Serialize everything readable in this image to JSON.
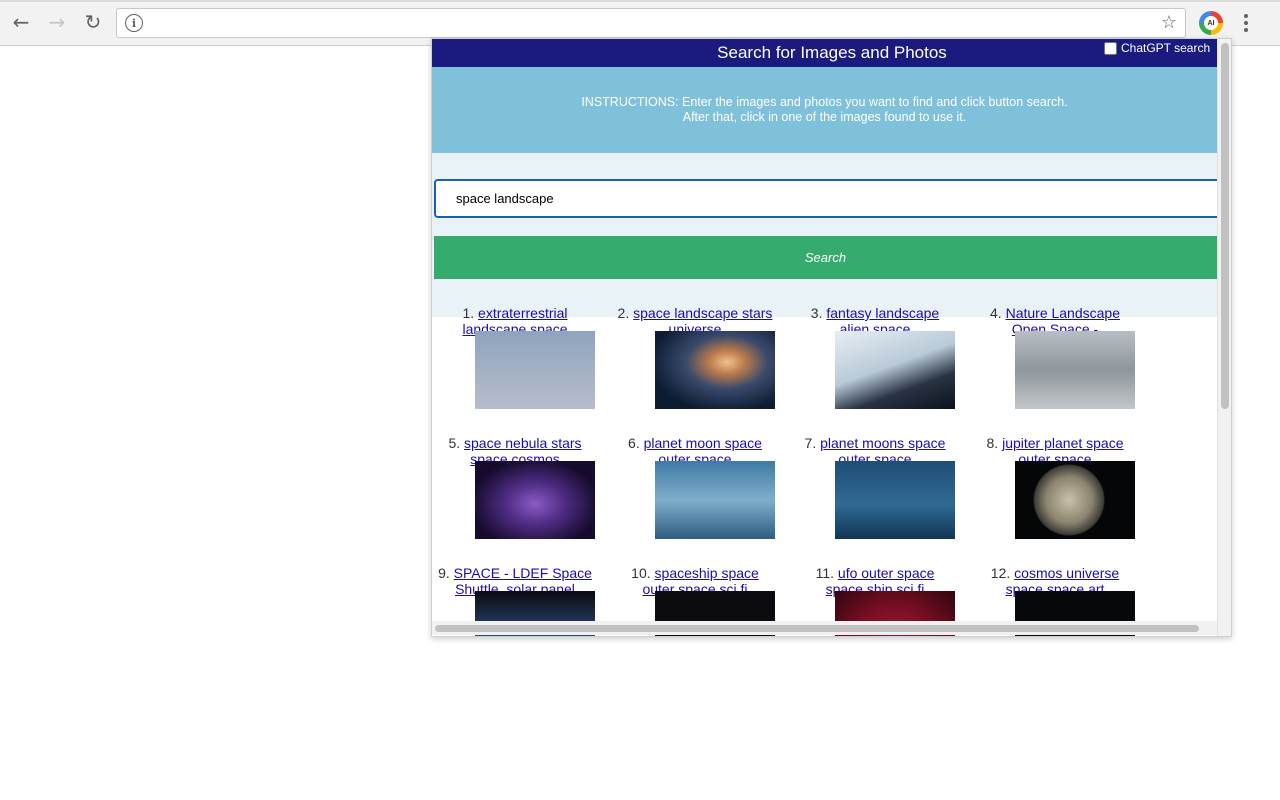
{
  "browser": {
    "url": "",
    "icons": {
      "back": "back-arrow-icon",
      "forward": "forward-arrow-icon",
      "reload": "reload-icon",
      "info": "info-icon",
      "bookmark": "star-icon",
      "extension": "ai-extension-icon",
      "menu": "more-vert-icon"
    }
  },
  "popup": {
    "title": "Search for Images and Photos",
    "chatgpt_label": "ChatGPT search",
    "instructions_line1": "INSTRUCTIONS: Enter the images and photos you want to find and click button search.",
    "instructions_line2": "After that, click in one of the images found to use it.",
    "search_value": "space landscape",
    "search_button": "Search",
    "colors": {
      "header": "#1b1b7f",
      "instructions": "#7fc0db",
      "search_button": "#35ab6e"
    }
  },
  "results": [
    {
      "index": "1.",
      "line1": "extraterrestrial",
      "line2": "landscape space"
    },
    {
      "index": "2.",
      "line1": "space landscape stars",
      "line2": "universe"
    },
    {
      "index": "3.",
      "line1": "fantasy landscape",
      "line2": "alien space"
    },
    {
      "index": "4.",
      "line1": "Nature Landscape",
      "line2": "Open Space -"
    },
    {
      "index": "5.",
      "line1": "space nebula stars",
      "line2": "space cosmos"
    },
    {
      "index": "6.",
      "line1": "planet moon space",
      "line2": "outer space"
    },
    {
      "index": "7.",
      "line1": "planet moons space",
      "line2": "outer space"
    },
    {
      "index": "8.",
      "line1": "jupiter planet space",
      "line2": "outer space"
    },
    {
      "index": "9.",
      "line1": "SPACE - LDEF Space",
      "line2": "Shuttle, solar panel"
    },
    {
      "index": "10.",
      "line1": "spaceship space",
      "line2": "outer space sci fi"
    },
    {
      "index": "11.",
      "line1": "ufo outer space",
      "line2": "space ship sci fi"
    },
    {
      "index": "12.",
      "line1": "cosmos universe",
      "line2": "space space art"
    }
  ]
}
